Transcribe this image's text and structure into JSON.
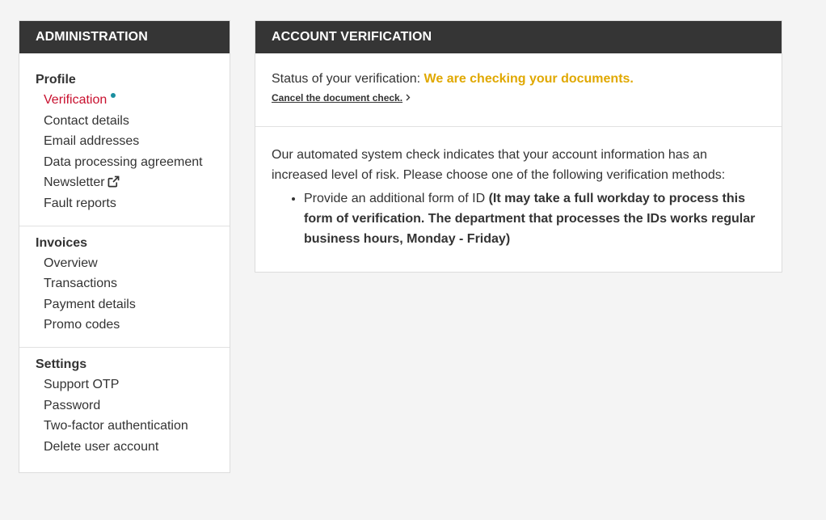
{
  "sidebar": {
    "title": "ADMINISTRATION",
    "sections": [
      {
        "heading": "Profile",
        "items": [
          {
            "label": "Verification"
          },
          {
            "label": "Contact details"
          },
          {
            "label": "Email addresses"
          },
          {
            "label": "Data processing agreement"
          },
          {
            "label": "Newsletter"
          },
          {
            "label": "Fault reports"
          }
        ]
      },
      {
        "heading": "Invoices",
        "items": [
          {
            "label": "Overview"
          },
          {
            "label": "Transactions"
          },
          {
            "label": "Payment details"
          },
          {
            "label": "Promo codes"
          }
        ]
      },
      {
        "heading": "Settings",
        "items": [
          {
            "label": "Support OTP"
          },
          {
            "label": "Password"
          },
          {
            "label": "Two-factor authentication"
          },
          {
            "label": "Delete user account"
          }
        ]
      }
    ],
    "icons": {
      "verification_indicator": "dot-indicator-icon",
      "newsletter": "external-link-icon"
    }
  },
  "main": {
    "title": "ACCOUNT VERIFICATION",
    "status_label": "Status of your verification: ",
    "status_value": "We are checking your documents.",
    "cancel_link": "Cancel the document check.",
    "cancel_icon": "chevron-right-icon",
    "info_text": "Our automated system check indicates that your account information has an increased level of risk. Please choose one of the following verification methods:",
    "methods": [
      {
        "label": "Provide an additional form of ID ",
        "note": "(It may take a full workday to process this form of verification. The department that processes the IDs works regular business hours, Monday - Friday)"
      }
    ]
  },
  "colors": {
    "header_bg": "#353535",
    "active_nav": "#c8102e",
    "status_value": "#e0a800",
    "indicator_dot": "#1b8fa0",
    "page_bg": "#f4f4f4"
  }
}
